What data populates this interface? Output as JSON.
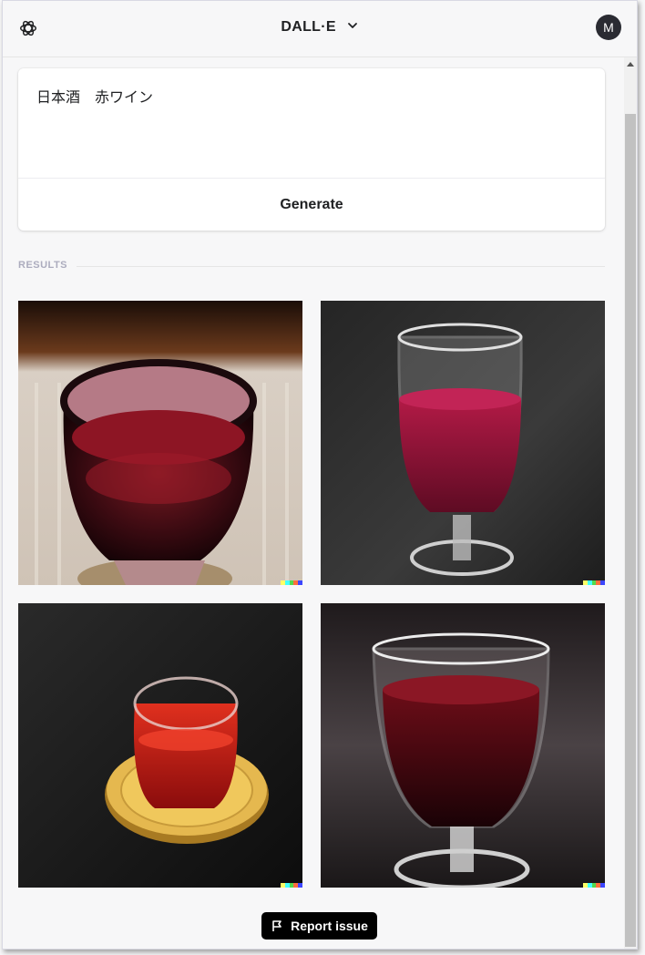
{
  "header": {
    "title": "DALL·E",
    "avatar_initial": "M",
    "logo_icon": "openai-logo-icon",
    "menu_icon": "chevron-down-icon"
  },
  "prompt": {
    "text": "日本酒　赤ワイン",
    "generate_label": "Generate"
  },
  "results": {
    "label": "RESULTS",
    "images": [
      {
        "subject": "dark red wine in a round purple-tinted glass on a striped cloth"
      },
      {
        "subject": "red wine in a tall stemmed glass on a dark grey surface"
      },
      {
        "subject": "red liquid in a small glass on a wooden coaster"
      },
      {
        "subject": "dark red wine in a stemmed glass on a dark background"
      }
    ],
    "signature_colors": [
      "#ffff66",
      "#42ffff",
      "#51da4c",
      "#ff6e3c",
      "#3c46ff"
    ]
  },
  "footer": {
    "report_label": "Report issue",
    "report_icon": "flag-icon"
  }
}
